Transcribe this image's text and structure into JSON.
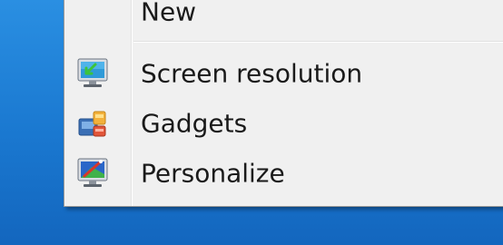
{
  "context_menu": {
    "items": [
      {
        "label": "New",
        "icon": "new-icon"
      },
      {
        "label": "Screen resolution",
        "icon": "screen-resolution-icon"
      },
      {
        "label": "Gadgets",
        "icon": "gadgets-icon"
      },
      {
        "label": "Personalize",
        "icon": "personalize-icon"
      }
    ]
  },
  "colors": {
    "desktop": "#1c7fd6",
    "menu_background": "#f0f0f0"
  }
}
